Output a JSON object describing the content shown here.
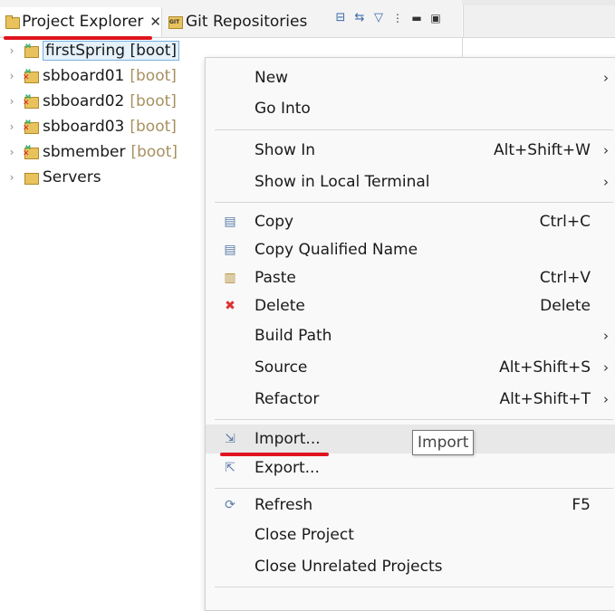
{
  "tabs": {
    "project_explorer": "Project Explorer",
    "git_repositories": "Git Repositories"
  },
  "tree": [
    {
      "name": "firstSpring",
      "tag": "[boot]",
      "selected": true,
      "error": false
    },
    {
      "name": "sbboard01",
      "tag": "[boot]",
      "selected": false,
      "error": true
    },
    {
      "name": "sbboard02",
      "tag": "[boot]",
      "selected": false,
      "error": true
    },
    {
      "name": "sbboard03",
      "tag": "[boot]",
      "selected": false,
      "error": true
    },
    {
      "name": "sbmember",
      "tag": "[boot]",
      "selected": false,
      "error": true
    },
    {
      "name": "Servers",
      "tag": "",
      "selected": false,
      "error": false
    }
  ],
  "menu": {
    "new": "New",
    "go_into": "Go Into",
    "show_in": "Show In",
    "show_in_accel": "Alt+Shift+W",
    "show_local_terminal": "Show in Local Terminal",
    "copy": "Copy",
    "copy_accel": "Ctrl+C",
    "copy_qualified_name": "Copy Qualified Name",
    "paste": "Paste",
    "paste_accel": "Ctrl+V",
    "delete": "Delete",
    "delete_accel": "Delete",
    "build_path": "Build Path",
    "source": "Source",
    "source_accel": "Alt+Shift+S",
    "refactor": "Refactor",
    "refactor_accel": "Alt+Shift+T",
    "import": "Import...",
    "export": "Export...",
    "refresh": "Refresh",
    "refresh_accel": "F5",
    "close_project": "Close Project",
    "close_unrelated": "Close Unrelated Projects"
  },
  "tooltip": "Import",
  "colors": {
    "annotation_red": "#e0141e",
    "boot_tag": "#a89060",
    "delete_icon": "#dd3333"
  }
}
